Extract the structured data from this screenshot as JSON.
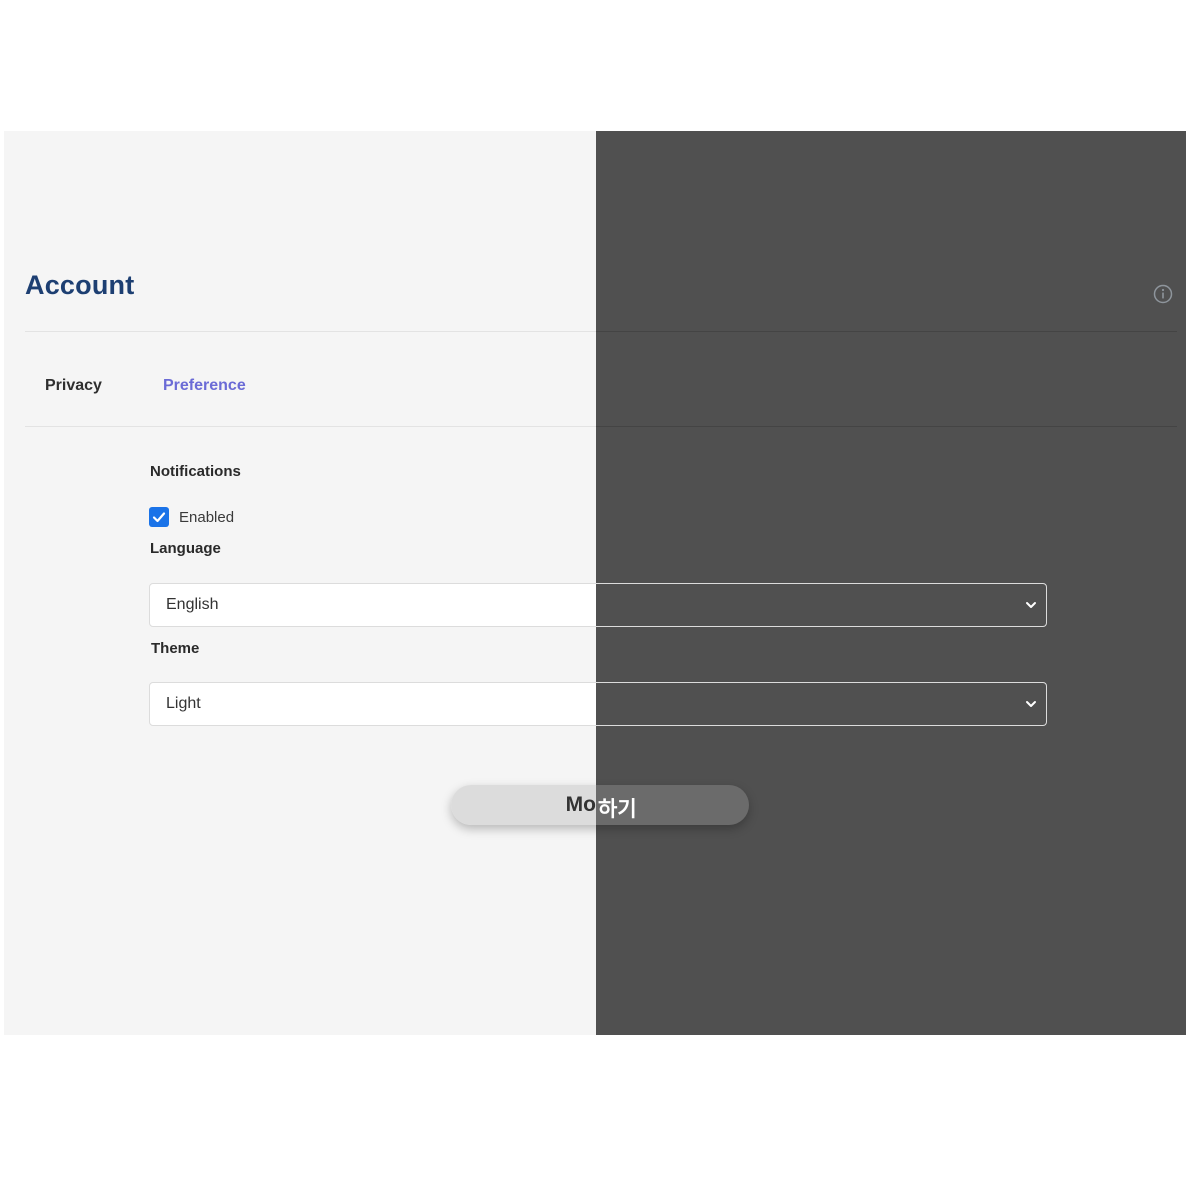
{
  "page": {
    "title": "Account"
  },
  "tabs": [
    {
      "label": "Privacy",
      "active": false
    },
    {
      "label": "Preference",
      "active": true
    }
  ],
  "notifications": {
    "label": "Notifications",
    "checkbox_label": "Enabled",
    "checked": true
  },
  "language": {
    "label": "Language",
    "value": "English"
  },
  "theme": {
    "label": "Theme",
    "value": "Light"
  },
  "mode_toggle": {
    "left_text": "Mo",
    "right_text": "하기"
  },
  "colors": {
    "title": "#1d3f72",
    "active_tab": "#6b6bd6",
    "checkbox": "#1a73e8",
    "light_bg": "#f5f5f5",
    "dark_bg": "#505050"
  },
  "icons": {
    "info": "info-circle-icon",
    "check": "check-icon",
    "chevron": "chevron-down-icon"
  }
}
